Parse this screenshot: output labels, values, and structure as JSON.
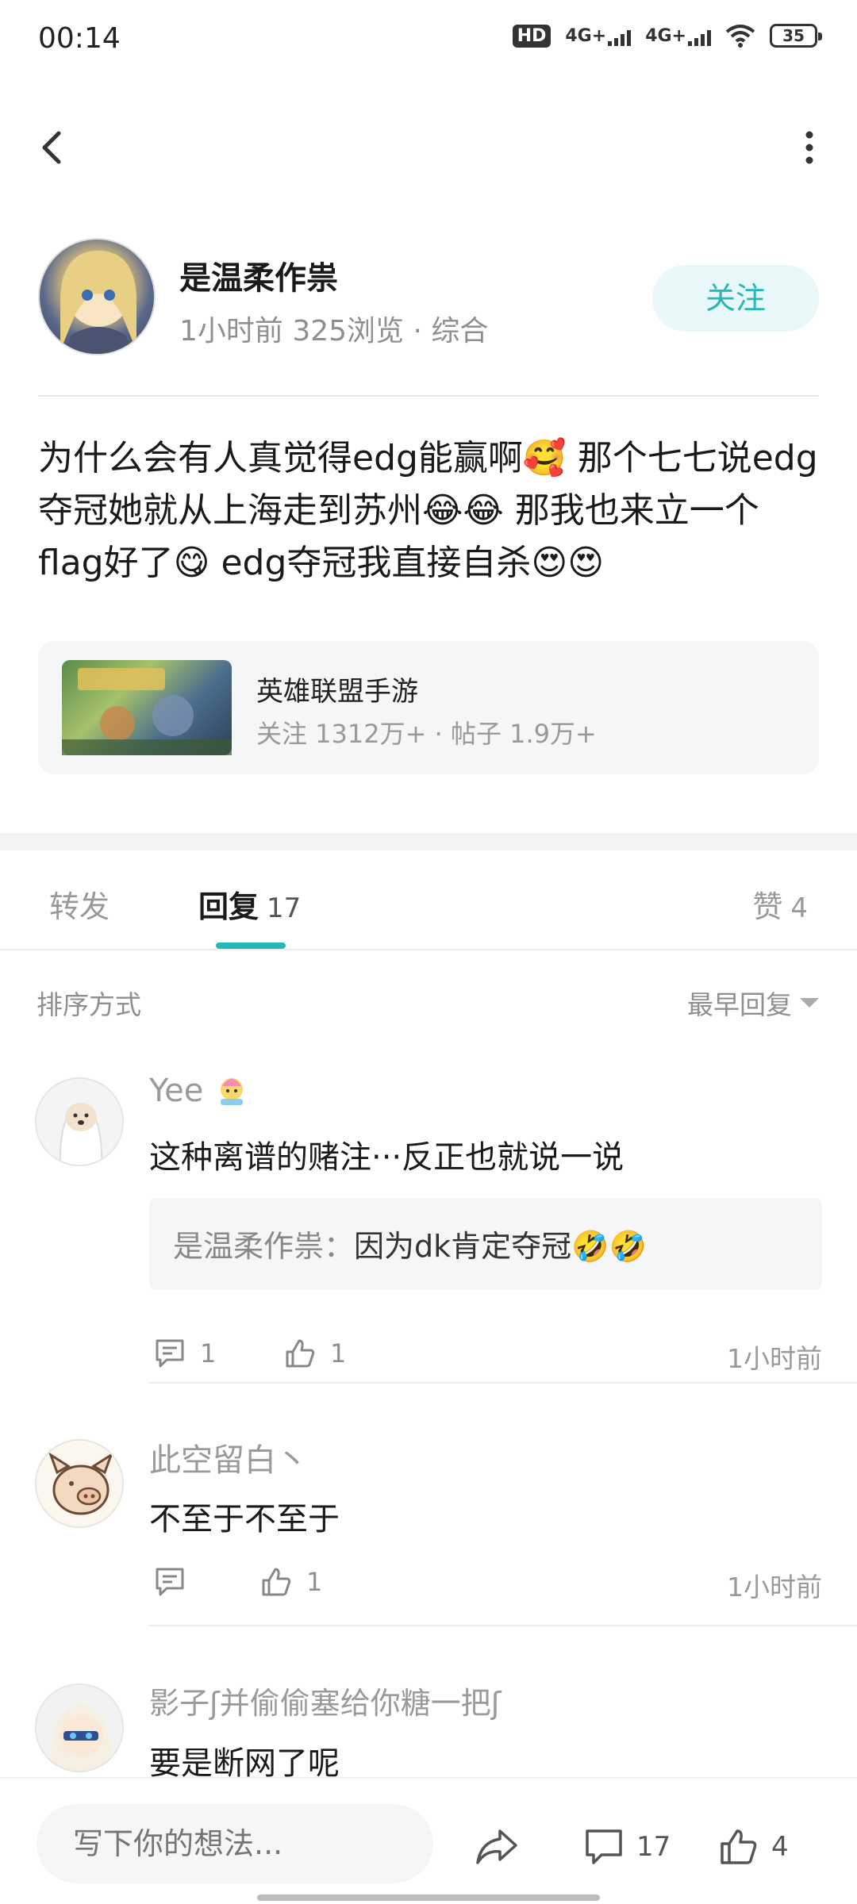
{
  "status_bar": {
    "time": "00:14",
    "hd": "HD",
    "net1": "4G+",
    "net2": "4G+",
    "battery": "35"
  },
  "author": {
    "name": "是温柔作祟",
    "meta": "1小时前  325浏览  ·  综合",
    "follow_label": "关注"
  },
  "post": {
    "text": "为什么会有人真觉得edg能赢啊🥰 那个七七说edg夺冠她就从上海走到苏州😂😂 那我也来立一个flag好了😋 edg夺冠我直接自杀😍😍"
  },
  "forum": {
    "name": "英雄联盟手游",
    "stats": "关注 1312万+  ·  帖子 1.9万+"
  },
  "tabs": {
    "forward": "转发",
    "reply": "回复",
    "reply_count": "17",
    "like": "赞",
    "like_count": "4"
  },
  "sort": {
    "label": "排序方式",
    "selected": "最早回复"
  },
  "comments": [
    {
      "name": "Yee",
      "text": "这种离谱的赌注···反正也就说一说",
      "quote_name": "是温柔作祟：",
      "quote_text": "因为dk肯定夺冠🤣🤣",
      "reply_count": "1",
      "like_count": "1",
      "time": "1小时前"
    },
    {
      "name": "此空留白丶",
      "text": "不至于不至于",
      "reply_count": "",
      "like_count": "1",
      "time": "1小时前"
    },
    {
      "name": "影子ʃ并偷偷塞给你糖一把ʃ",
      "text": "要是断网了呢"
    }
  ],
  "bottom_bar": {
    "input_placeholder": "写下你的想法...",
    "reply_count": "17",
    "like_count": "4"
  },
  "colors": {
    "accent": "#26b8b8",
    "follow_bg": "#e8f8f8",
    "muted_text": "#8f8f8f",
    "card_bg": "#f5f6f8"
  }
}
